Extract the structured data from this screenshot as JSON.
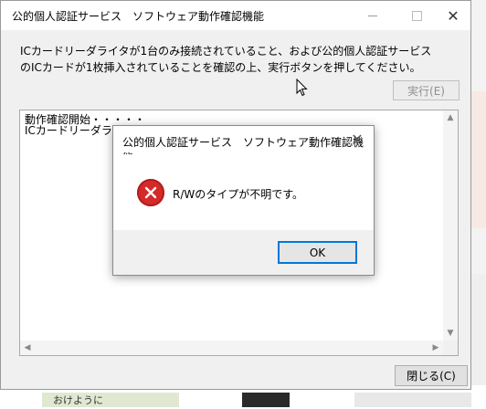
{
  "main_window": {
    "title": "公的個人認証サービス　ソフトウェア動作確認機能",
    "instruction_line1": "ICカードリーダライタが1台のみ接続されていること、および公的個人認証サービス",
    "instruction_line2": "のICカードが1枚挿入されていることを確認の上、実行ボタンを押してください。",
    "execute_label": "実行(E)",
    "log_text": "動作確認開始・・・・・\nICカードリーダライタ",
    "close_label": "閉じる(C)"
  },
  "dialog": {
    "title": "公的個人認証サービス　ソフトウェア動作確認機能",
    "message": "R/Wのタイプが不明です。",
    "ok_label": "OK",
    "icon": "error-icon"
  },
  "background": {
    "partial_text": "おけように"
  },
  "colors": {
    "error_red": "#d42a2a",
    "focus_blue": "#0078d7",
    "disabled_text": "#8f8f8f"
  }
}
